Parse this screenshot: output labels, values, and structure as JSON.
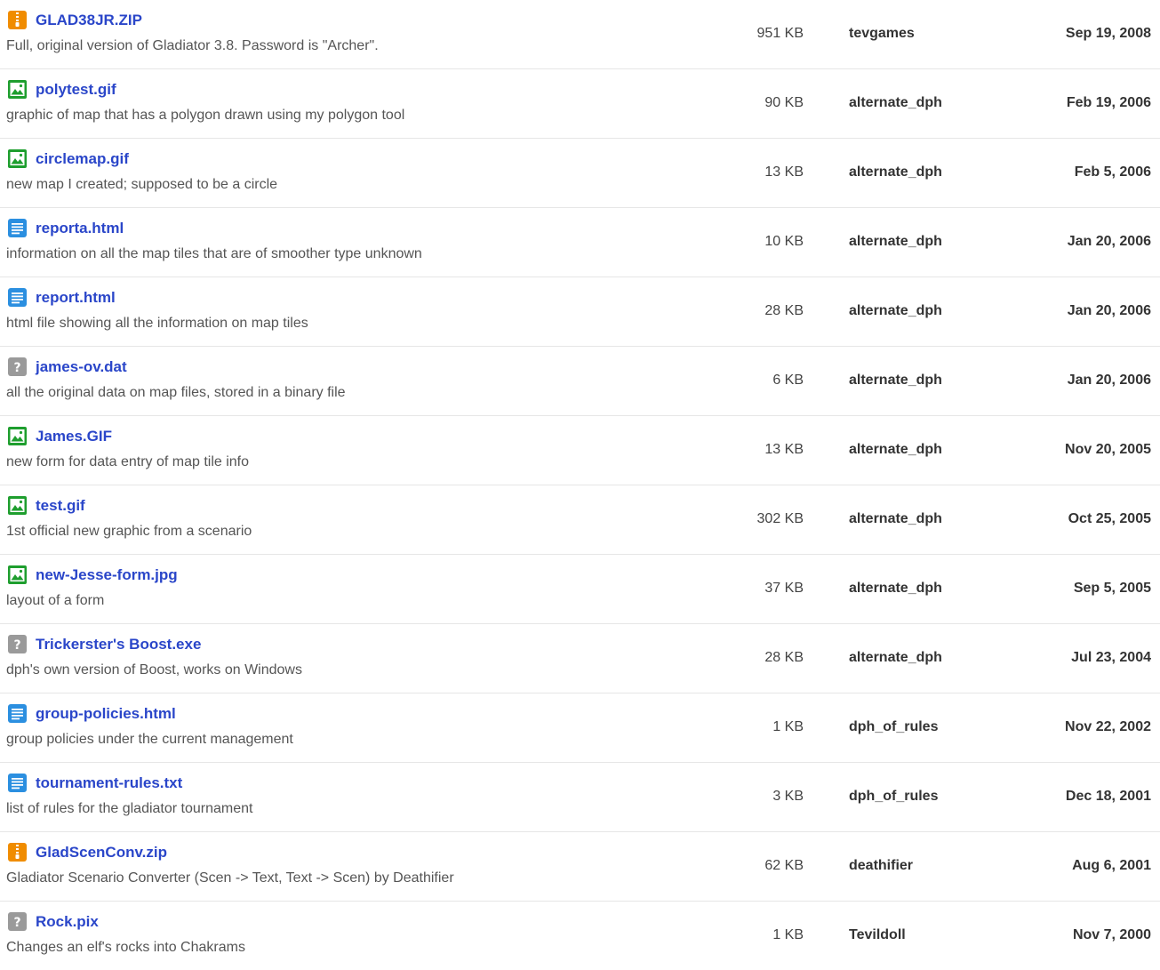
{
  "colors": {
    "link": "#2a46c9",
    "archive_icon": "#f08c00",
    "image_icon": "#1e9e2e",
    "document_icon": "#2b8fe0",
    "unknown_icon": "#9a9a9a"
  },
  "files": [
    {
      "name": "GLAD38JR.ZIP",
      "desc": "Full, original version of Gladiator 3.8. Password is \"Archer\".",
      "size": "951 KB",
      "uploader": "tevgames",
      "date": "Sep 19, 2008",
      "icon": "archive-icon"
    },
    {
      "name": "polytest.gif",
      "desc": "graphic of map that has a polygon drawn using my polygon tool",
      "size": "90 KB",
      "uploader": "alternate_dph",
      "date": "Feb 19, 2006",
      "icon": "image-icon"
    },
    {
      "name": "circlemap.gif",
      "desc": "new map I created; supposed to be a circle",
      "size": "13 KB",
      "uploader": "alternate_dph",
      "date": "Feb 5, 2006",
      "icon": "image-icon"
    },
    {
      "name": "reporta.html",
      "desc": "information on all the map tiles that are of smoother type unknown",
      "size": "10 KB",
      "uploader": "alternate_dph",
      "date": "Jan 20, 2006",
      "icon": "document-icon"
    },
    {
      "name": "report.html",
      "desc": "html file showing all the information on map tiles",
      "size": "28 KB",
      "uploader": "alternate_dph",
      "date": "Jan 20, 2006",
      "icon": "document-icon"
    },
    {
      "name": "james-ov.dat",
      "desc": "all the original data on map files, stored in a binary file",
      "size": "6 KB",
      "uploader": "alternate_dph",
      "date": "Jan 20, 2006",
      "icon": "unknown-file-icon"
    },
    {
      "name": "James.GIF",
      "desc": "new form for data entry of map tile info",
      "size": "13 KB",
      "uploader": "alternate_dph",
      "date": "Nov 20, 2005",
      "icon": "image-icon"
    },
    {
      "name": "test.gif",
      "desc": "1st official new graphic from a scenario",
      "size": "302 KB",
      "uploader": "alternate_dph",
      "date": "Oct 25, 2005",
      "icon": "image-icon"
    },
    {
      "name": "new-Jesse-form.jpg",
      "desc": "layout of a form",
      "size": "37 KB",
      "uploader": "alternate_dph",
      "date": "Sep 5, 2005",
      "icon": "image-icon"
    },
    {
      "name": "Trickerster's Boost.exe",
      "desc": "dph's own version of Boost, works on Windows",
      "size": "28 KB",
      "uploader": "alternate_dph",
      "date": "Jul 23, 2004",
      "icon": "unknown-file-icon"
    },
    {
      "name": "group-policies.html",
      "desc": "group policies under the current management",
      "size": "1 KB",
      "uploader": "dph_of_rules",
      "date": "Nov 22, 2002",
      "icon": "document-icon"
    },
    {
      "name": "tournament-rules.txt",
      "desc": "list of rules for the gladiator tournament",
      "size": "3 KB",
      "uploader": "dph_of_rules",
      "date": "Dec 18, 2001",
      "icon": "document-icon"
    },
    {
      "name": "GladScenConv.zip",
      "desc": "Gladiator Scenario Converter (Scen -> Text, Text -> Scen) by Deathifier",
      "size": "62 KB",
      "uploader": "deathifier",
      "date": "Aug 6, 2001",
      "icon": "archive-icon"
    },
    {
      "name": "Rock.pix",
      "desc": "Changes an elf's rocks into Chakrams",
      "size": "1 KB",
      "uploader": "Tevildoll",
      "date": "Nov 7, 2000",
      "icon": "unknown-file-icon"
    }
  ]
}
